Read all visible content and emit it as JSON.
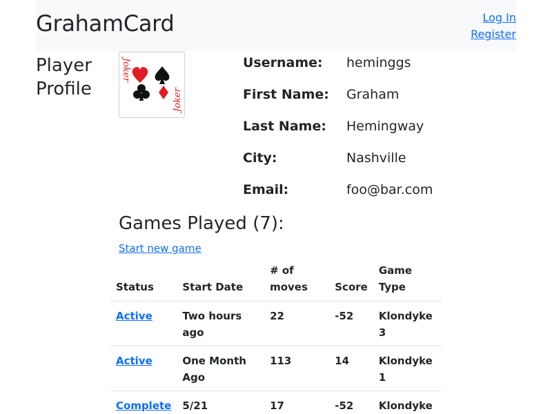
{
  "navbar": {
    "brand": "GrahamCard",
    "login": "Log In",
    "register": "Register"
  },
  "profile": {
    "title_line1": "Player",
    "title_line2": "Profile",
    "card_text": "Joker",
    "fields": [
      {
        "label": "Username:",
        "value": "heminggs"
      },
      {
        "label": "First Name:",
        "value": "Graham"
      },
      {
        "label": "Last Name:",
        "value": "Hemingway"
      },
      {
        "label": "City:",
        "value": "Nashville"
      },
      {
        "label": "Email:",
        "value": "foo@bar.com"
      }
    ]
  },
  "games": {
    "title": "Games Played (7):",
    "start_link": "Start new game",
    "headers": {
      "status": "Status",
      "start_date": "Start Date",
      "moves_line1": "# of",
      "moves_line2": "moves",
      "score": "Score",
      "game_type": "Game Type"
    },
    "rows": [
      {
        "status": "Active",
        "start_date": "Two hours ago",
        "moves": "22",
        "score": "-52",
        "type_line1": "Klondyke",
        "type_line2": "3"
      },
      {
        "status": "Active",
        "start_date_line1": "One Month",
        "start_date_line2": "Ago",
        "moves": "113",
        "score": "14",
        "type_line1": "Klondyke",
        "type_line2": "1"
      },
      {
        "status": "Complete",
        "start_date": "5/21",
        "moves": "17",
        "score": "-52",
        "type_line1": "Klondyke"
      }
    ]
  },
  "colors": {
    "link": "#0d6efd",
    "navbar_bg": "#f8f9fa",
    "card_red": "#e31b23",
    "card_black": "#111111"
  }
}
